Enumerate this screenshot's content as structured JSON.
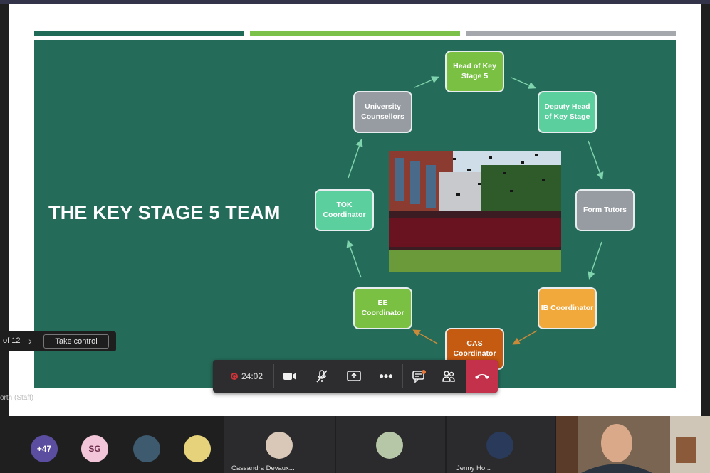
{
  "slide": {
    "title": "THE KEY STAGE 5 TEAM",
    "accent_bars": [
      "#1f6b57",
      "#7cc14a",
      "#a5a8ad"
    ],
    "background": "#256b59",
    "nodes": [
      {
        "id": "head",
        "label": "Head of Key Stage 5",
        "color": "#7ac143"
      },
      {
        "id": "deputy",
        "label": "Deputy Head of Key Stage",
        "color": "#5ccf9e"
      },
      {
        "id": "form",
        "label": "Form Tutors",
        "color": "#979ca3"
      },
      {
        "id": "ib",
        "label": "IB Coordinator",
        "color": "#f2a93b"
      },
      {
        "id": "cas",
        "label": "CAS Coordinator",
        "color": "#c55a11"
      },
      {
        "id": "ee",
        "label": "EE Coordinator",
        "color": "#7ac143"
      },
      {
        "id": "tok",
        "label": "TOK Coordinator",
        "color": "#5ccf9e"
      },
      {
        "id": "uni",
        "label": "University Counsellors",
        "color": "#979ca3"
      }
    ]
  },
  "presenter_controls": {
    "page_count": "of 12",
    "take_control_label": "Take control"
  },
  "presenter_name": "orth (Staff)",
  "call_toolbar": {
    "recording_time": "24:02",
    "icons": [
      "record-icon",
      "camera-icon",
      "mic-off-icon",
      "share-screen-icon",
      "more-icon",
      "chat-icon",
      "participants-icon",
      "hang-up-icon"
    ]
  },
  "participants": {
    "overflow": "+47",
    "initials": "SG",
    "names": [
      "Cassandra Devaux...",
      "Jenny Ho..."
    ]
  }
}
